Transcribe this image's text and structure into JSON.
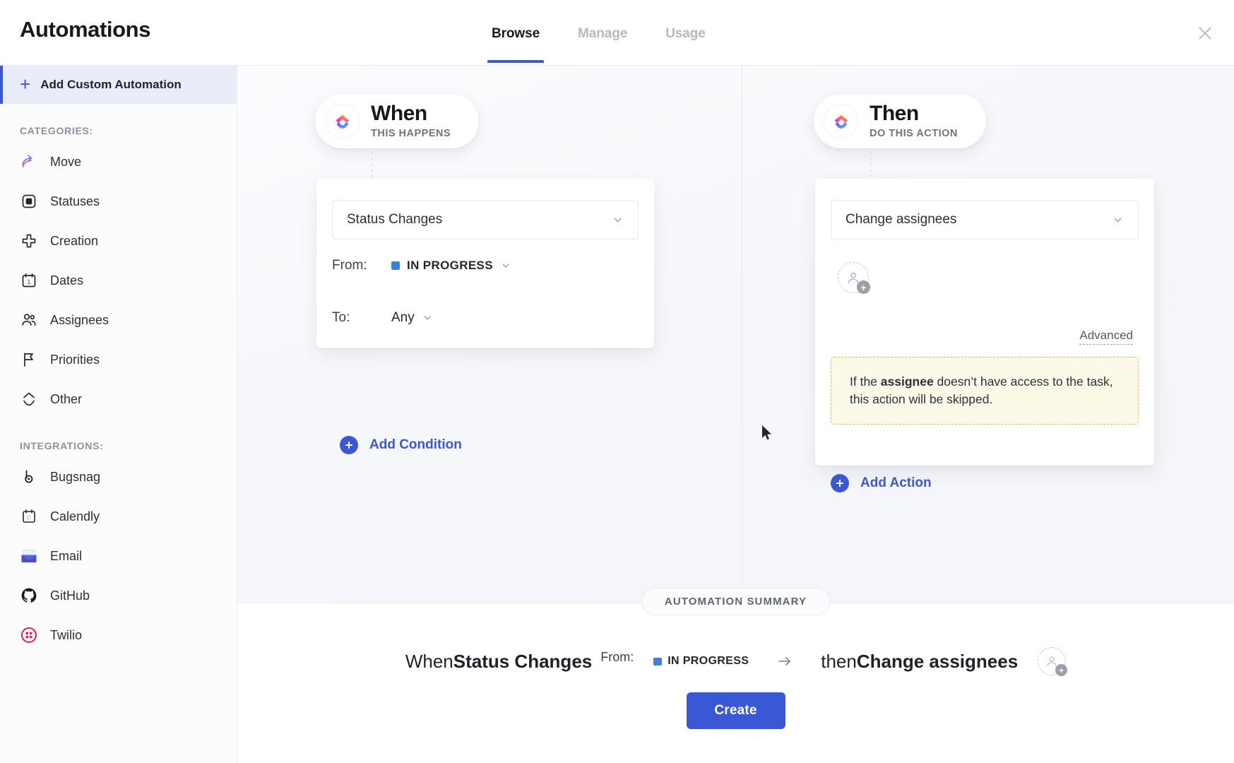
{
  "header": {
    "title": "Automations",
    "tabs": [
      {
        "label": "Browse",
        "active": true
      },
      {
        "label": "Manage",
        "active": false
      },
      {
        "label": "Usage",
        "active": false
      }
    ],
    "close_label": "✕"
  },
  "sidebar": {
    "add_custom_label": "Add Custom Automation",
    "add_custom_plus": "+",
    "categories_label": "CATEGORIES:",
    "categories": [
      {
        "label": "Move",
        "icon": "move-arrow-icon"
      },
      {
        "label": "Statuses",
        "icon": "status-square-icon"
      },
      {
        "label": "Creation",
        "icon": "plus-cross-icon"
      },
      {
        "label": "Dates",
        "icon": "calendar-icon"
      },
      {
        "label": "Assignees",
        "icon": "people-icon"
      },
      {
        "label": "Priorities",
        "icon": "flag-icon"
      },
      {
        "label": "Other",
        "icon": "clickup-chevron-icon"
      }
    ],
    "integrations_label": "INTEGRATIONS:",
    "integrations": [
      {
        "label": "Bugsnag",
        "icon": "bugsnag-icon"
      },
      {
        "label": "Calendly",
        "icon": "calendly-icon"
      },
      {
        "label": "Email",
        "icon": "email-icon"
      },
      {
        "label": "GitHub",
        "icon": "github-icon"
      },
      {
        "label": "Twilio",
        "icon": "twilio-icon"
      }
    ]
  },
  "when": {
    "pill_title": "When",
    "pill_subtitle": "THIS HAPPENS",
    "trigger_value": "Status Changes",
    "conditions": [
      {
        "label": "From:",
        "value": "IN PROGRESS",
        "has_dot": true,
        "dot_color": "#3f80d4"
      },
      {
        "label": "To:",
        "value": "Any",
        "has_dot": false
      }
    ],
    "add_condition_label": "Add Condition",
    "add_plus": "+"
  },
  "then": {
    "pill_title": "Then",
    "pill_subtitle": "DO THIS ACTION",
    "action_value": "Change assignees",
    "advanced_label": "Advanced",
    "warning_prefix": "If the ",
    "warning_bold": "assignee",
    "warning_suffix": " doesn’t have access to the task, this action will be skipped.",
    "add_action_label": "Add Action",
    "add_plus": "+"
  },
  "flow": {
    "arrow_glyph": "→"
  },
  "summary": {
    "chip_label": "AUTOMATION SUMMARY",
    "when_word": "When ",
    "trigger": "Status Changes",
    "from_label": "From:",
    "status_value": "IN PROGRESS",
    "arrow": "→",
    "then_word": "then ",
    "action": "Change assignees",
    "create_label": "Create"
  },
  "colors": {
    "accent_blue": "#3a58d6",
    "status_blue": "#3f80d4",
    "warning_bg": "#fdf9e9",
    "warning_border": "#e3b94f"
  }
}
